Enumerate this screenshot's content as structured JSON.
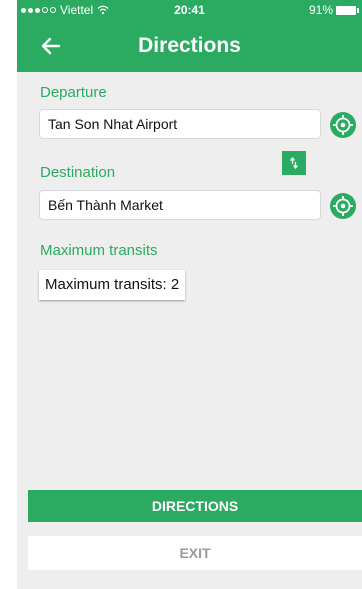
{
  "status_bar": {
    "carrier": "Viettel",
    "time": "20:41",
    "battery": "91%",
    "signal_icon": "signal-dots-icon",
    "wifi_icon": "wifi-icon",
    "battery_icon": "battery-icon"
  },
  "header": {
    "title": "Directions",
    "back_icon": "back-arrow-icon"
  },
  "departure": {
    "label": "Departure",
    "value": "Tan Son Nhat Airport",
    "locate_icon": "locate-target-icon"
  },
  "destination": {
    "label": "Destination",
    "value": "Bến Thành Market",
    "locate_icon": "locate-target-icon",
    "swap_icon": "swap-arrows-icon"
  },
  "transits": {
    "label": "Maximum transits",
    "value": "Maximum transits: 2"
  },
  "actions": {
    "directions_label": "DIRECTIONS",
    "exit_label": "EXIT"
  },
  "colors": {
    "accent": "#2bab61",
    "background": "#eeeeee",
    "exit_text": "#9a9a9a"
  }
}
